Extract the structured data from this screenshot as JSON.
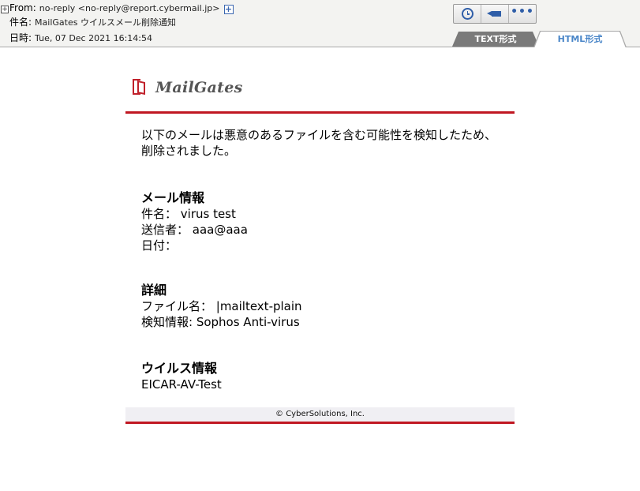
{
  "header": {
    "from_label": "From:",
    "from_value": "no-reply <no-reply@report.cybermail.jp>",
    "subject_label": "件名:",
    "subject_value": "MailGates ウイルスメール削除通知",
    "date_label": "日時:",
    "date_value": "Tue, 07 Dec 2021 16:14:54",
    "expand_glyph": "+",
    "add_glyph": "+",
    "tabs": [
      {
        "label": "TEXT形式",
        "active": false
      },
      {
        "label": "HTML形式",
        "active": true
      }
    ],
    "toolbar_icons": [
      "clock-icon",
      "tag-icon",
      "more-icon"
    ]
  },
  "mail": {
    "logo_text": "MailGates",
    "intro": "以下のメールは悪意のあるファイルを含む可能性を検知したため、削除されました。",
    "mail_info": {
      "title": "メール情報",
      "lines": [
        "件名： virus test",
        "送信者： aaa@aaa",
        "日付："
      ]
    },
    "detail": {
      "title": "詳細",
      "lines": [
        "ファイル名： |mailtext-plain",
        "検知情報: Sophos Anti-virus"
      ]
    },
    "virus_info": {
      "title": "ウイルス情報",
      "lines": [
        "EICAR-AV-Test"
      ]
    },
    "footer": "© CyberSolutions, Inc."
  },
  "colors": {
    "brand_red": "#c01722",
    "tab_blue": "#4a86c8",
    "icon_blue": "#2f5ea8"
  }
}
